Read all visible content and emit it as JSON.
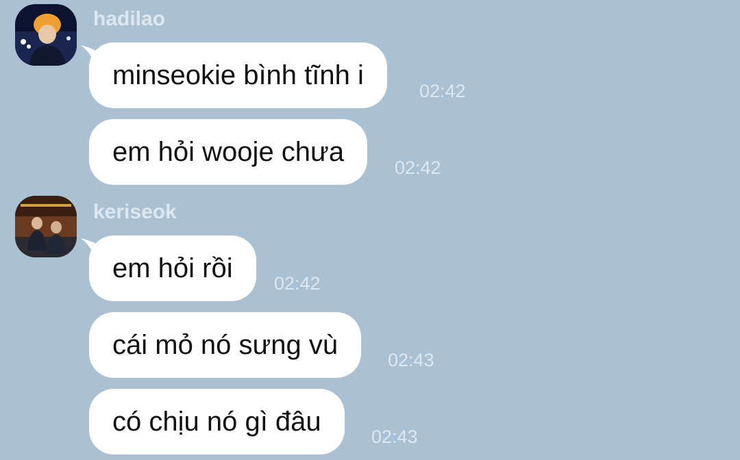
{
  "groups": [
    {
      "sender": "hadilao",
      "messages": [
        {
          "text": "minseokie bình tĩnh i",
          "time": "02:42"
        },
        {
          "text": "em hỏi wooje chưa",
          "time": "02:42"
        }
      ]
    },
    {
      "sender": "keriseok",
      "messages": [
        {
          "text": "em hỏi rồi",
          "time": "02:42"
        },
        {
          "text": "cái mỏ nó sưng vù",
          "time": "02:43"
        },
        {
          "text": "có chịu nó gì đâu",
          "time": "02:43"
        }
      ]
    }
  ],
  "colors": {
    "background": "#a9c1d3",
    "bubble": "#ffffff",
    "meta_text": "#dde7ef"
  }
}
